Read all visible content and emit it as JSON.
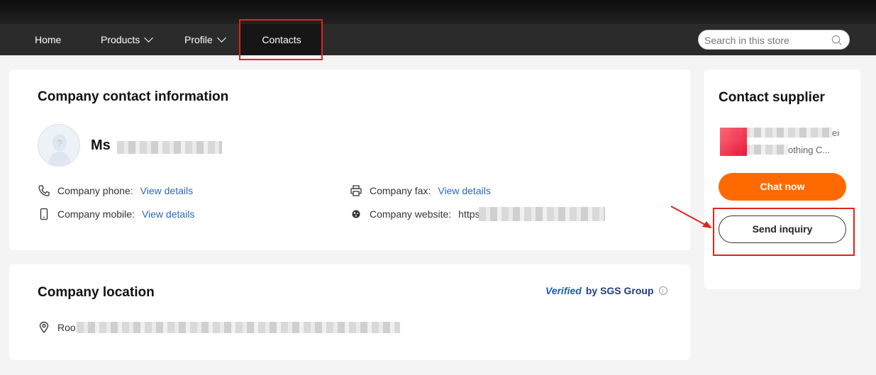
{
  "nav": {
    "home": "Home",
    "products": "Products",
    "profile": "Profile",
    "contacts": "Contacts",
    "search_placeholder": "Search in this store"
  },
  "contact_card": {
    "title": "Company contact information",
    "person_name": "Ms",
    "phone_label": "Company phone:",
    "phone_link": "View details",
    "mobile_label": "Company mobile:",
    "mobile_link": "View details",
    "fax_label": "Company fax:",
    "fax_link": "View details",
    "website_label": "Company website:",
    "website_value": "https"
  },
  "location_card": {
    "title": "Company location",
    "verified_word": "Verified",
    "verified_by": "by SGS Group",
    "address": "Roo"
  },
  "supplier_card": {
    "title": "Contact supplier",
    "name_line1": "ei",
    "name_line2": "othing C...",
    "chat_button": "Chat now",
    "inquiry_button": "Send inquiry"
  },
  "colors": {
    "accent_orange": "#ff6a00",
    "link_blue": "#2a69b8",
    "highlight_red": "#e2231a"
  }
}
